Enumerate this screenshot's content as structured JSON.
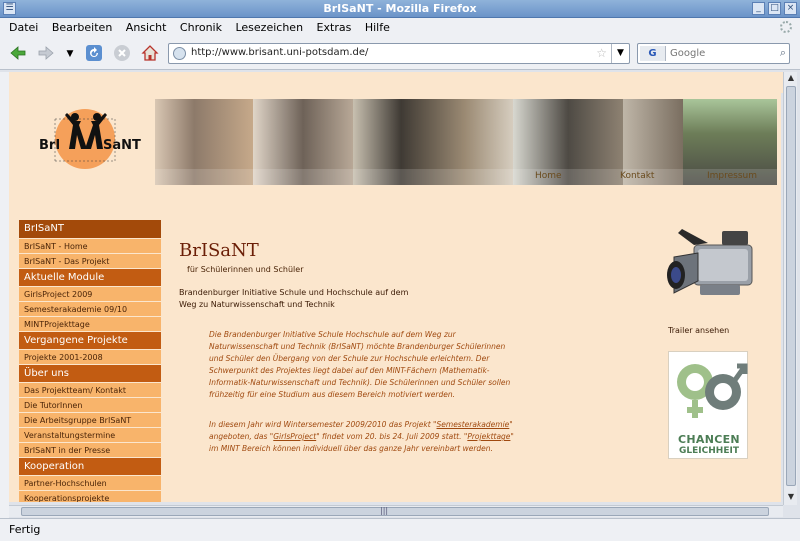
{
  "window": {
    "title": "BrISaNT - Mozilla Firefox"
  },
  "menu": [
    "Datei",
    "Bearbeiten",
    "Ansicht",
    "Chronik",
    "Lesezeichen",
    "Extras",
    "Hilfe"
  ],
  "nav": {
    "url": "http://www.brisant.uni-potsdam.de/",
    "search_placeholder": "Google",
    "search_engine": "G"
  },
  "status": "Fertig",
  "logo": {
    "text_left": "BrI",
    "text_right": "SaNT"
  },
  "banner_links": [
    "Home",
    "Kontakt",
    "Impressum"
  ],
  "sidebar": [
    {
      "type": "head",
      "label": "BrISaNT"
    },
    {
      "type": "item",
      "label": "BrISaNT - Home"
    },
    {
      "type": "item",
      "label": "BrISaNT - Das Projekt"
    },
    {
      "type": "head",
      "label": "Aktuelle Module"
    },
    {
      "type": "item",
      "label": "GirlsProject 2009"
    },
    {
      "type": "item",
      "label": "Semesterakademie 09/10"
    },
    {
      "type": "item",
      "label": "MINTProjekttage"
    },
    {
      "type": "head",
      "label": "Vergangene Projekte"
    },
    {
      "type": "item",
      "label": "Projekte 2001-2008"
    },
    {
      "type": "head",
      "label": "Über uns"
    },
    {
      "type": "item",
      "label": "Das Projektteam/ Kontakt"
    },
    {
      "type": "item",
      "label": "Die TutorInnen"
    },
    {
      "type": "item",
      "label": "Die Arbeitsgruppe BrISaNT"
    },
    {
      "type": "item",
      "label": "Veranstaltungstermine"
    },
    {
      "type": "item",
      "label": "BrISaNT in der Presse"
    },
    {
      "type": "head",
      "label": "Kooperation"
    },
    {
      "type": "item",
      "label": "Partner-Hochschulen"
    },
    {
      "type": "item",
      "label": "Kooperationsprojekte"
    }
  ],
  "main": {
    "title": "BrISaNT",
    "subtitle": "für Schülerinnen und Schüler",
    "intro": "Brandenburger Initiative Schule und Hochschule auf dem Weg zu Naturwissenschaft und Technik",
    "para1": "Die Brandenburger Initiative Schule Hochschule auf dem Weg zur Naturwissenschaft und Technik (BrISaNT) möchte Brandenburger Schülerinnen und Schüler den Übergang von der Schule zur Hochschule erleichtern. Der Schwerpunkt des Projektes liegt dabei auf den MINT-Fächern (Mathematik-Informatik-Naturwissenschaft und Technik). Die Schülerinnen und Schüler sollen frühzeitig für eine Studium aus diesem Bereich motiviert werden.",
    "para2_a": "In diesem Jahr wird Wintersemester 2009/2010 das Projekt \"",
    "link1": "Semesterakademie",
    "para2_b": "\" angeboten, das \"",
    "link2": "GirlsProject",
    "para2_c": "\" findet vom 20. bis 24. Juli 2009 statt. \"",
    "link3": "Projekttage",
    "para2_d": "\" im MINT Bereich können individuell über das ganze Jahr vereinbart werden."
  },
  "aside": {
    "trailer": "Trailer ansehen",
    "chancen": "CHANCEN",
    "gleichheit": "GLEICHHEIT"
  }
}
